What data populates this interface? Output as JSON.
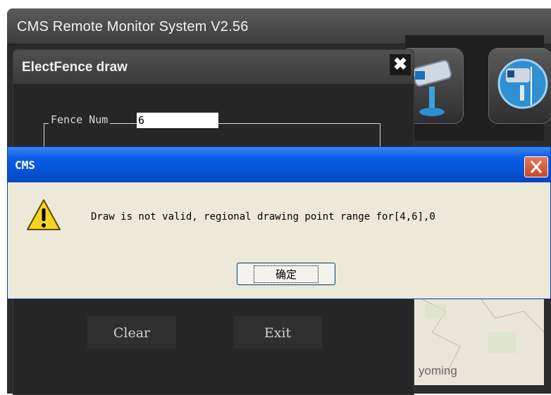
{
  "app": {
    "title": "CMS Remote Monitor System V2.56"
  },
  "fence_dialog": {
    "title": "ElectFence draw",
    "close_glyph": "✖",
    "fence_num_label": "Fence Num",
    "fence_num_value": "6",
    "clear_label": "Clear",
    "exit_label": "Exit"
  },
  "toolbar": {
    "icons": [
      "camera-icon",
      "ptz-camera-icon"
    ]
  },
  "map": {
    "visible_label": "yoming"
  },
  "message_box": {
    "title": "CMS",
    "text": "Draw is not valid, regional drawing point range for[4,6],0",
    "ok_label": "确定",
    "accent": "#0a5ce6"
  }
}
